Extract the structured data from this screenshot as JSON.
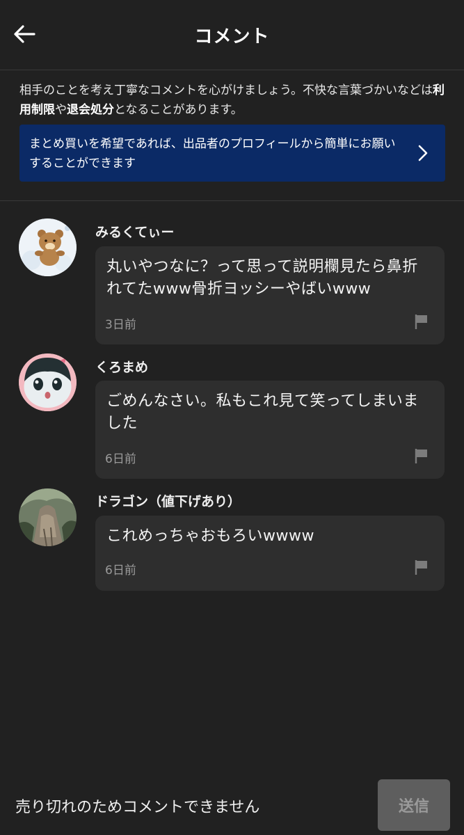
{
  "header": {
    "title": "コメント"
  },
  "notice": {
    "part1": "相手のことを考え丁寧なコメントを心がけましょう。不快な言葉づかいなどは",
    "bold1": "利用制限",
    "part2": "や",
    "bold2": "退会処分",
    "part3": "となることがあります。"
  },
  "banner": {
    "text": "まとめ買いを希望であれば、出品者のプロフィールから簡単にお願いすることができます",
    "bg_color": "#0b2a66"
  },
  "comments": [
    {
      "username": "みるくてぃー",
      "text": "丸いやつなに？って思って説明欄見たら鼻折れてたwww骨折ヨッシーやばいwww",
      "time": "3日前",
      "avatar_icon": "bear-avatar"
    },
    {
      "username": "くろまめ",
      "text": "ごめんなさい。私もこれ見て笑ってしまいました",
      "time": "6日前",
      "avatar_icon": "character-avatar"
    },
    {
      "username": "ドラゴン（値下げあり）",
      "text": "これめっちゃおもろいwwww",
      "time": "6日前",
      "avatar_icon": "rock-landscape-avatar"
    }
  ],
  "footer": {
    "message": "売り切れのためコメントできません",
    "send_label": "送信"
  },
  "colors": {
    "background": "#212121",
    "bubble": "#2e2e2e",
    "muted_text": "#9a9a9a",
    "disabled_button": "#5e5e5e"
  }
}
